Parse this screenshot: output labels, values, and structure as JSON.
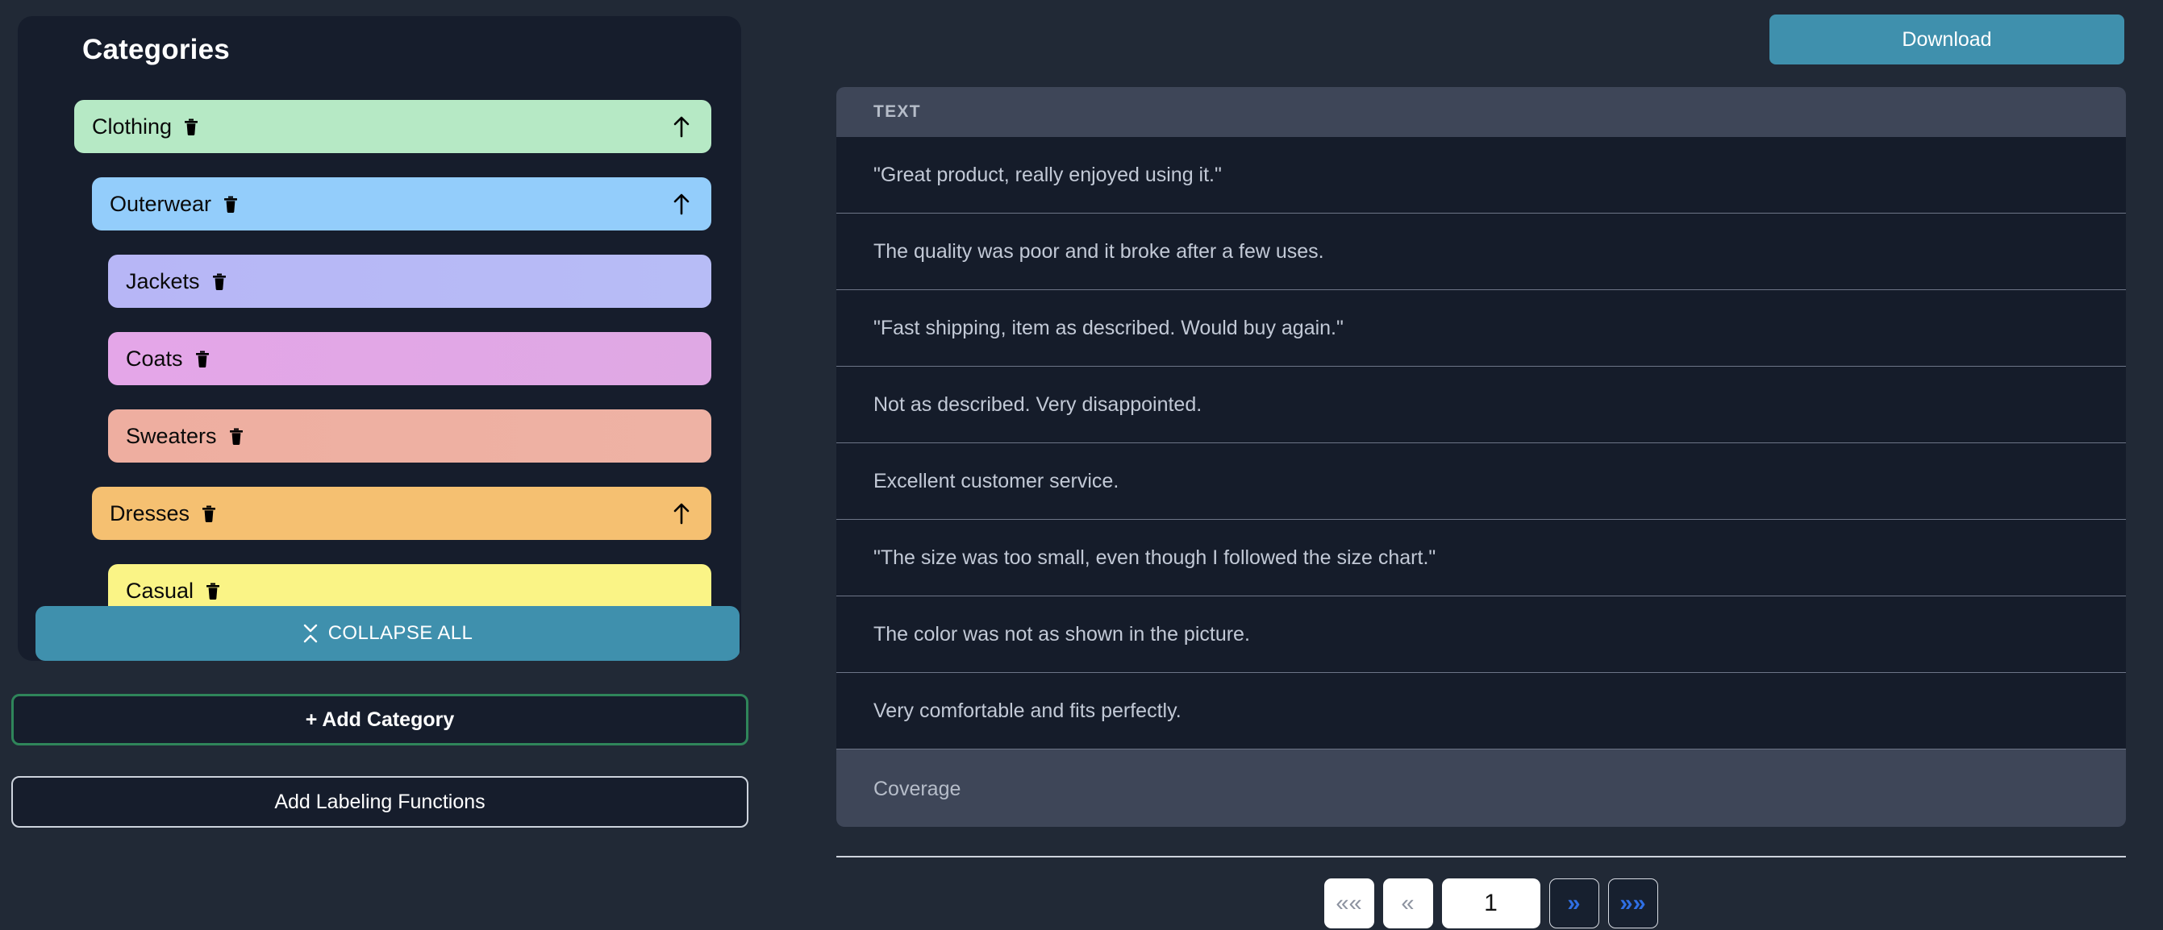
{
  "sidebar": {
    "title": "Categories",
    "categories": [
      {
        "label": "Clothing",
        "depth": 0,
        "color": "#b6e9c5",
        "color2": "#b6e9c5",
        "has_arrow": true,
        "trash": "trash-icon",
        "arrow": "arrow-up-icon"
      },
      {
        "label": "Outerwear",
        "depth": 1,
        "color": "#93cdfb",
        "color2": "#93cdfb",
        "has_arrow": true,
        "trash": "trash-icon",
        "arrow": "arrow-up-icon"
      },
      {
        "label": "Jackets",
        "depth": 2,
        "color": "#b7b6f6",
        "color2": "#b7bcf6",
        "has_arrow": false,
        "trash": "trash-icon",
        "arrow": ""
      },
      {
        "label": "Coats",
        "depth": 2,
        "color": "#e4a6e8",
        "color2": "#dfa8e4",
        "has_arrow": false,
        "trash": "trash-icon",
        "arrow": ""
      },
      {
        "label": "Sweaters",
        "depth": 2,
        "color": "#eeaea0",
        "color2": "#eeb2a4",
        "has_arrow": false,
        "trash": "trash-icon",
        "arrow": ""
      },
      {
        "label": "Dresses",
        "depth": 1,
        "color": "#f5c071",
        "color2": "#f5c071",
        "has_arrow": true,
        "trash": "trash-icon",
        "arrow": "arrow-up-icon"
      },
      {
        "label": "Casual",
        "depth": 2,
        "color": "#faf486",
        "color2": "#faf486",
        "has_arrow": false,
        "trash": "trash-icon",
        "arrow": ""
      }
    ],
    "collapse_all_label": "COLLAPSE ALL",
    "collapse_all_icon": "collapse-icon",
    "add_category_label": "+ Add Category",
    "add_labeling_functions_label": "Add Labeling Functions"
  },
  "main": {
    "download_label": "Download",
    "table": {
      "columns": [
        "TEXT"
      ],
      "rows": [
        {
          "text": "\"Great product, really enjoyed using it.\""
        },
        {
          "text": "The quality was poor and it broke after a few uses."
        },
        {
          "text": "\"Fast shipping, item as described. Would buy again.\""
        },
        {
          "text": "Not as described. Very disappointed."
        },
        {
          "text": "Excellent customer service."
        },
        {
          "text": "\"The size was too small, even though I followed the size chart.\""
        },
        {
          "text": "The color was not as shown in the picture."
        },
        {
          "text": "Very comfortable and fits perfectly."
        }
      ],
      "footer_label": "Coverage"
    },
    "pagination": {
      "first_label": "««",
      "prev_label": "«",
      "page_value": "1",
      "next_label": "»",
      "last_label": "»»"
    }
  },
  "colors": {
    "page_bg": "#212936",
    "card_bg": "#161d2c",
    "accent_teal": "#3f90ad",
    "accent_green": "#2f855a",
    "accent_blue": "#2f6fe4",
    "table_head_bg": "#3e4658",
    "table_row_bg": "#151c2a"
  }
}
